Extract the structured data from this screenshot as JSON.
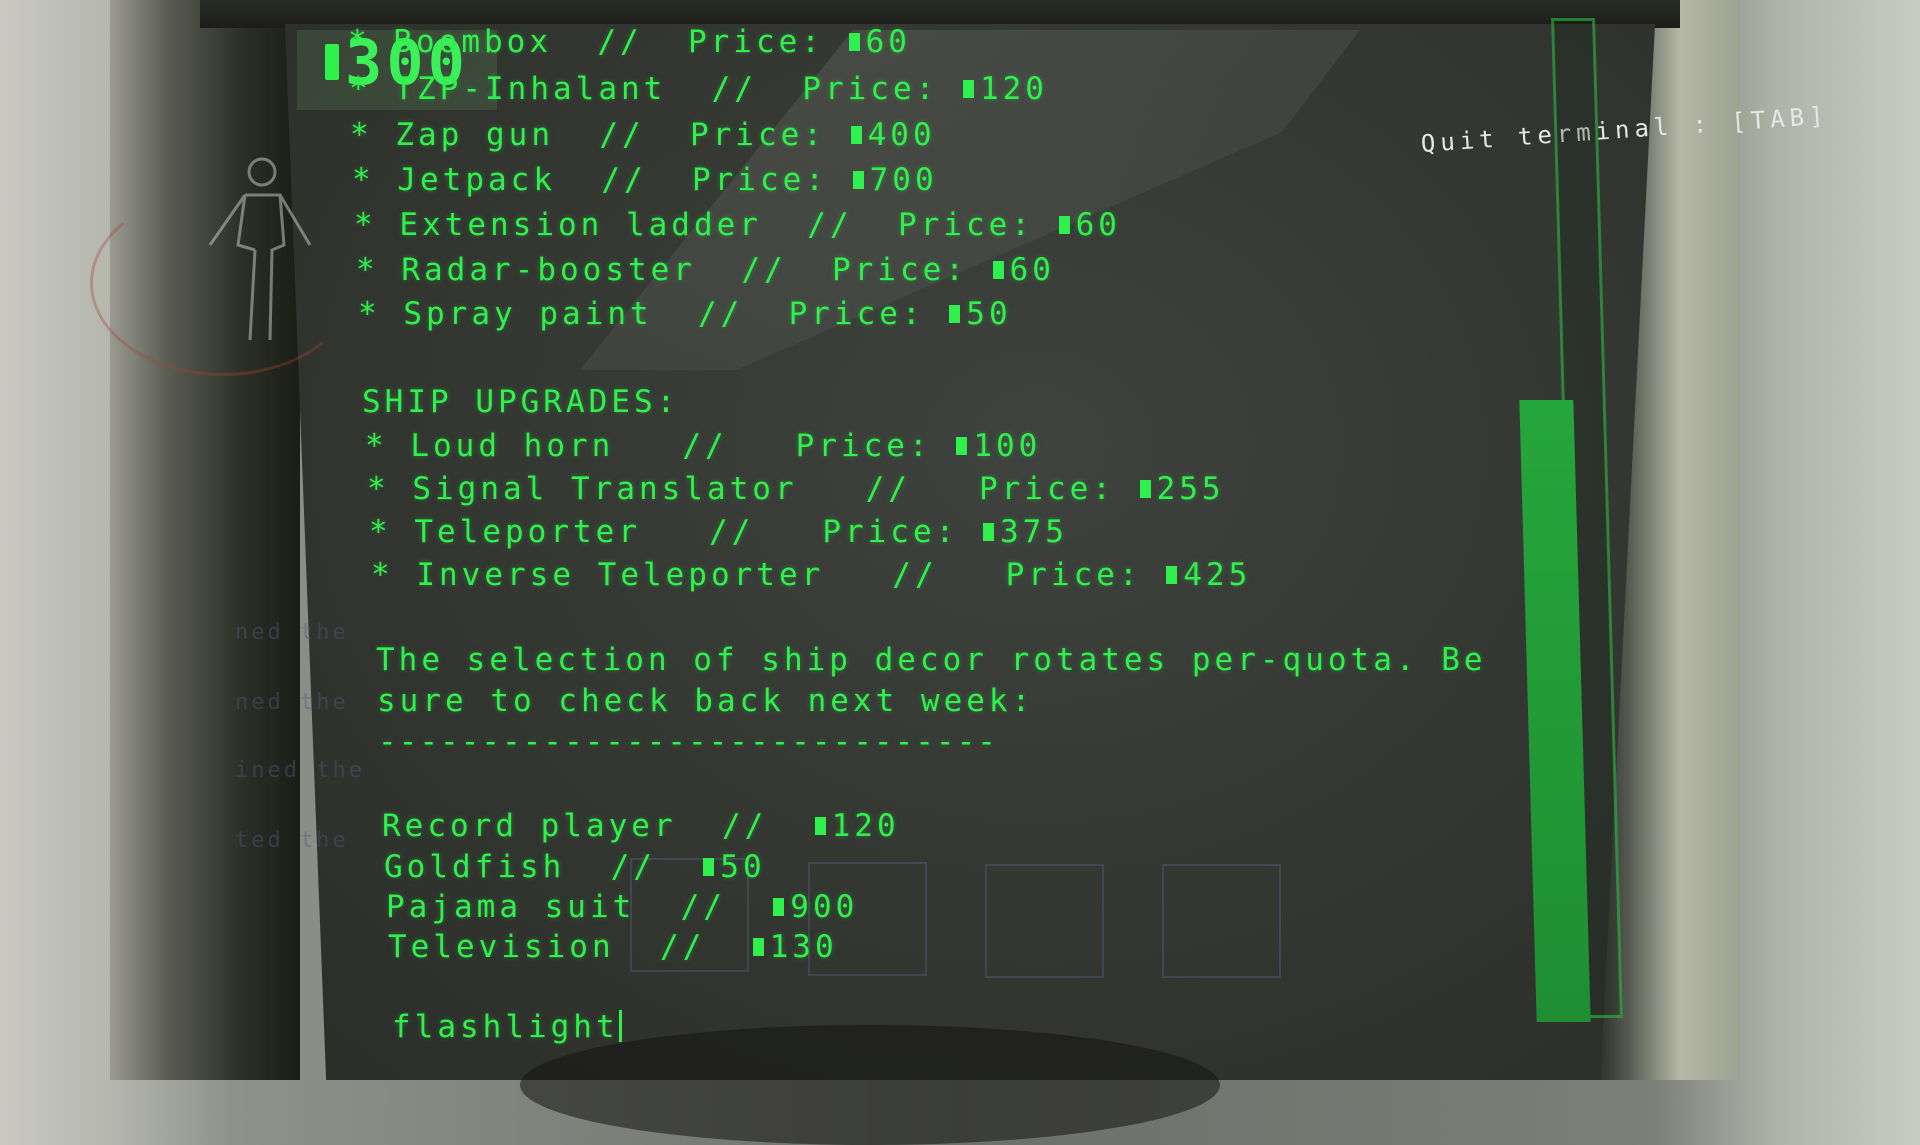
{
  "hud": {
    "credits": "300",
    "quit_hint": "Quit terminal : [TAB]"
  },
  "store": {
    "tools": [
      {
        "bullet": "*",
        "name": "Boombox",
        "sep": "//",
        "price_label": "Price:",
        "price": "60"
      },
      {
        "bullet": "*",
        "name": "TZP-Inhalant",
        "sep": "//",
        "price_label": "Price:",
        "price": "120"
      },
      {
        "bullet": "*",
        "name": "Zap gun",
        "sep": "//",
        "price_label": "Price:",
        "price": "400"
      },
      {
        "bullet": "*",
        "name": "Jetpack",
        "sep": "//",
        "price_label": "Price:",
        "price": "700"
      },
      {
        "bullet": "*",
        "name": "Extension ladder",
        "sep": "//",
        "price_label": "Price:",
        "price": "60"
      },
      {
        "bullet": "*",
        "name": "Radar-booster",
        "sep": "//",
        "price_label": "Price:",
        "price": "60"
      },
      {
        "bullet": "*",
        "name": "Spray paint",
        "sep": "//",
        "price_label": "Price:",
        "price": "50"
      }
    ],
    "upgrades_heading": "SHIP UPGRADES:",
    "upgrades": [
      {
        "bullet": "*",
        "name": "Loud horn",
        "sep": "//",
        "price_label": "Price:",
        "price": "100"
      },
      {
        "bullet": "*",
        "name": "Signal Translator",
        "sep": "//",
        "price_label": "Price:",
        "price": "255"
      },
      {
        "bullet": "*",
        "name": "Teleporter",
        "sep": "//",
        "price_label": "Price:",
        "price": "375"
      },
      {
        "bullet": "*",
        "name": "Inverse Teleporter",
        "sep": "//",
        "price_label": "Price:",
        "price": "425"
      }
    ],
    "decor_note_line1": "The selection of ship decor rotates per-quota. Be",
    "decor_note_line2": "sure to check back next week:",
    "divider": "------------------------------",
    "decor": [
      {
        "name": "Record player",
        "sep": "//",
        "price": "120"
      },
      {
        "name": "Goldfish",
        "sep": "//",
        "price": "50"
      },
      {
        "name": "Pajama suit",
        "sep": "//",
        "price": "900"
      },
      {
        "name": "Television",
        "sep": "//",
        "price": "130"
      }
    ]
  },
  "input": {
    "value": "flashlight"
  },
  "background_text": [
    "ned the",
    "ned the",
    "ined the",
    "ted the"
  ],
  "colors": {
    "terminal_green": "#30f04e",
    "screen_bg": "#353833",
    "scrollbar": "#25a63a"
  }
}
